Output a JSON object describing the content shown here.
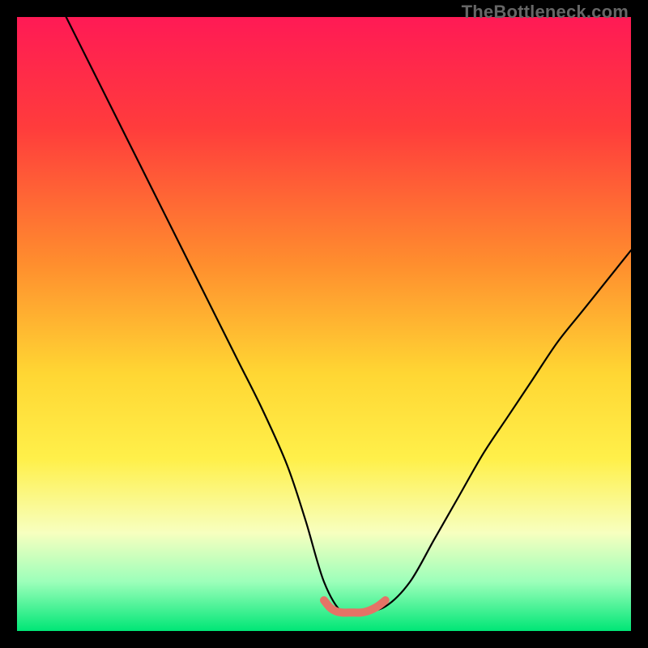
{
  "watermark": "TheBottleneck.com",
  "chart_data": {
    "type": "line",
    "title": "",
    "xlabel": "",
    "ylabel": "",
    "xlim": [
      0,
      100
    ],
    "ylim": [
      0,
      100
    ],
    "gradient_stops": [
      {
        "offset": 0,
        "color": "#ff1a55"
      },
      {
        "offset": 18,
        "color": "#ff3c3c"
      },
      {
        "offset": 40,
        "color": "#ff8d2e"
      },
      {
        "offset": 58,
        "color": "#ffd633"
      },
      {
        "offset": 72,
        "color": "#fff04a"
      },
      {
        "offset": 84,
        "color": "#f7ffbf"
      },
      {
        "offset": 92,
        "color": "#9cffba"
      },
      {
        "offset": 100,
        "color": "#00e676"
      }
    ],
    "series": [
      {
        "name": "bottleneck-curve",
        "color": "#000000",
        "x": [
          8,
          12,
          16,
          20,
          24,
          28,
          32,
          36,
          40,
          44,
          47,
          50,
          53,
          56,
          60,
          64,
          68,
          72,
          76,
          80,
          84,
          88,
          92,
          96,
          100
        ],
        "y": [
          100,
          92,
          84,
          76,
          68,
          60,
          52,
          44,
          36,
          27,
          18,
          8,
          3,
          3,
          4,
          8,
          15,
          22,
          29,
          35,
          41,
          47,
          52,
          57,
          62
        ]
      },
      {
        "name": "optimal-zone-marker",
        "color": "#e57366",
        "x": [
          50,
          51,
          52,
          53,
          54,
          55,
          56,
          57,
          58,
          59,
          60
        ],
        "y": [
          5,
          3.8,
          3.2,
          3,
          3,
          3,
          3,
          3.2,
          3.6,
          4.2,
          5
        ]
      }
    ]
  }
}
